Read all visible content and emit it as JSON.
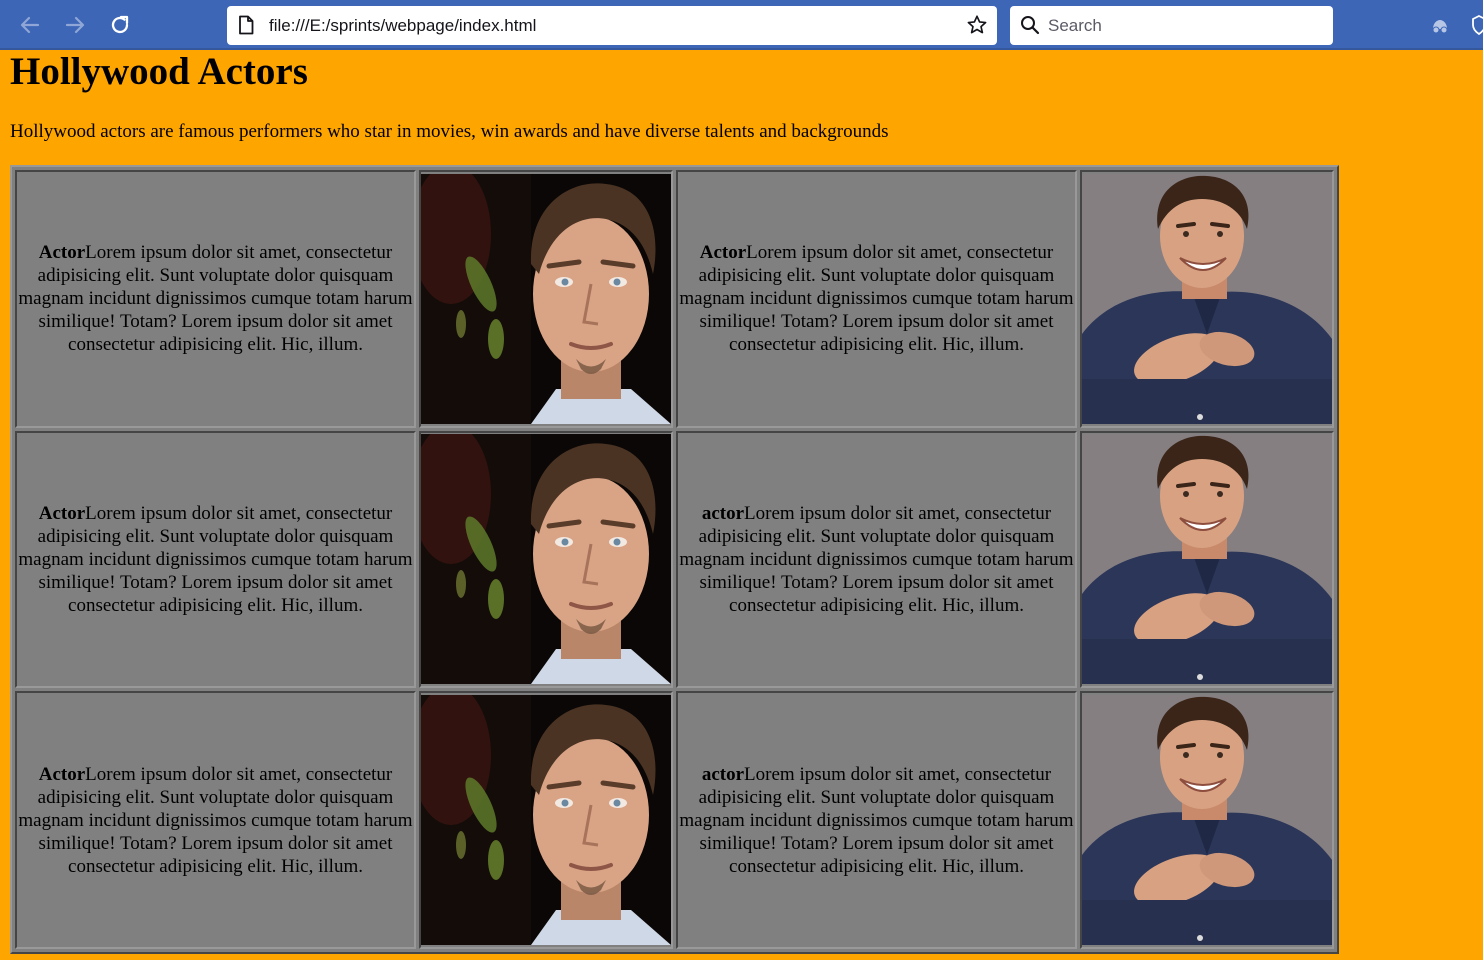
{
  "browser": {
    "url": "file:///E:/sprints/webpage/index.html",
    "search_placeholder": "Search",
    "colors": {
      "toolbar": "#3d66b6",
      "page_bg": "#ffa500",
      "table_bg": "#808080"
    }
  },
  "page": {
    "title": "Hollywood Actors",
    "intro": "Hollywood actors are famous performers who star in movies, win awards and have diverse talents and backgrounds"
  },
  "rows": [
    {
      "left": {
        "label": "Actor",
        "text": "Lorem ipsum dolor sit amet, consectetur adipisicing elit. Sunt voluptate dolor quisquam magnam incidunt dignissimos cumque totam harum similique! Totam? Lorem ipsum dolor sit amet consectetur adipisicing elit. Hic, illum."
      },
      "right": {
        "label": "Actor",
        "text": "Lorem ipsum dolor sit amet, consectetur adipisicing elit. Sunt voluptate dolor quisquam magnam incidunt dignissimos cumque totam harum similique! Totam? Lorem ipsum dolor sit amet consectetur adipisicing elit. Hic, illum."
      }
    },
    {
      "left": {
        "label": "Actor",
        "text": "Lorem ipsum dolor sit amet, consectetur adipisicing elit. Sunt voluptate dolor quisquam magnam incidunt dignissimos cumque totam harum similique! Totam? Lorem ipsum dolor sit amet consectetur adipisicing elit. Hic, illum."
      },
      "right": {
        "label": "actor",
        "text": "Lorem ipsum dolor sit amet, consectetur adipisicing elit. Sunt voluptate dolor quisquam magnam incidunt dignissimos cumque totam harum similique! Totam? Lorem ipsum dolor sit amet consectetur adipisicing elit. Hic, illum."
      }
    },
    {
      "left": {
        "label": "Actor",
        "text": "Lorem ipsum dolor sit amet, consectetur adipisicing elit. Sunt voluptate dolor quisquam magnam incidunt dignissimos cumque totam harum similique! Totam? Lorem ipsum dolor sit amet consectetur adipisicing elit. Hic, illum."
      },
      "right": {
        "label": "actor",
        "text": "Lorem ipsum dolor sit amet, consectetur adipisicing elit. Sunt voluptate dolor quisquam magnam incidunt dignissimos cumque totam harum similique! Totam? Lorem ipsum dolor sit amet consectetur adipisicing elit. Hic, illum."
      }
    }
  ]
}
